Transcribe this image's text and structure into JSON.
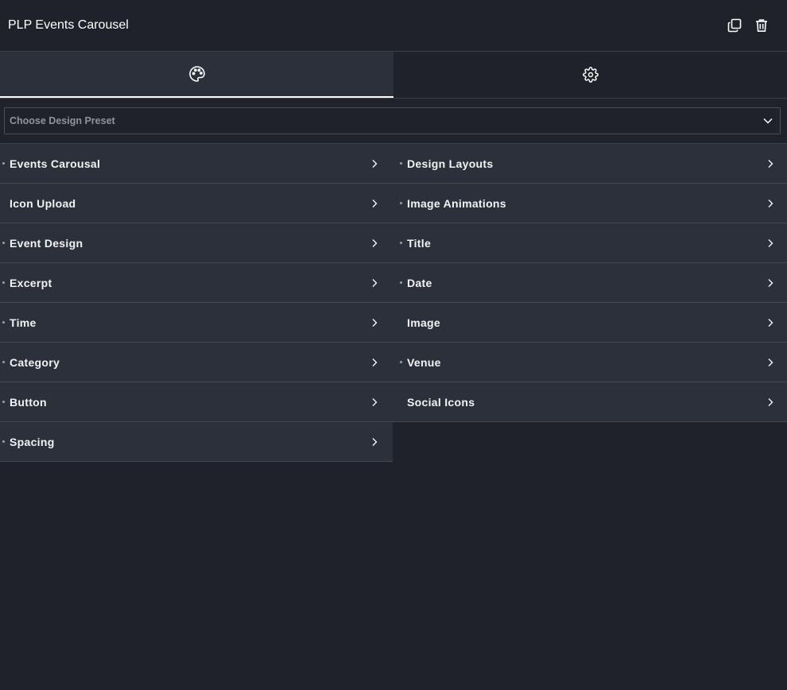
{
  "header": {
    "title": "PLP Events Carousel",
    "actions": [
      {
        "icon": "duplicate-icon"
      },
      {
        "icon": "trash-icon"
      }
    ]
  },
  "tabs": [
    {
      "icon": "palette-icon",
      "active": true
    },
    {
      "icon": "gear-icon",
      "active": false
    }
  ],
  "preset": {
    "placeholder": "Choose Design Preset"
  },
  "sections": {
    "left": [
      {
        "label": "Events Carousal",
        "dot": true
      },
      {
        "label": "Icon Upload",
        "dot": false
      },
      {
        "label": "Event Design",
        "dot": true
      },
      {
        "label": "Excerpt",
        "dot": true
      },
      {
        "label": "Time",
        "dot": true
      },
      {
        "label": "Category",
        "dot": true
      },
      {
        "label": "Button",
        "dot": true
      },
      {
        "label": "Spacing",
        "dot": true
      }
    ],
    "right": [
      {
        "label": "Design Layouts",
        "dot": true
      },
      {
        "label": "Image Animations",
        "dot": true
      },
      {
        "label": "Title",
        "dot": true
      },
      {
        "label": "Date",
        "dot": true
      },
      {
        "label": "Image",
        "dot": false
      },
      {
        "label": "Venue",
        "dot": true
      },
      {
        "label": "Social Icons",
        "dot": false
      }
    ]
  },
  "colors": {
    "background": "#1f222a",
    "row": "#2c303a",
    "divider": "#3a3f4b",
    "text": "#ffffff",
    "muted": "#8e939d"
  }
}
